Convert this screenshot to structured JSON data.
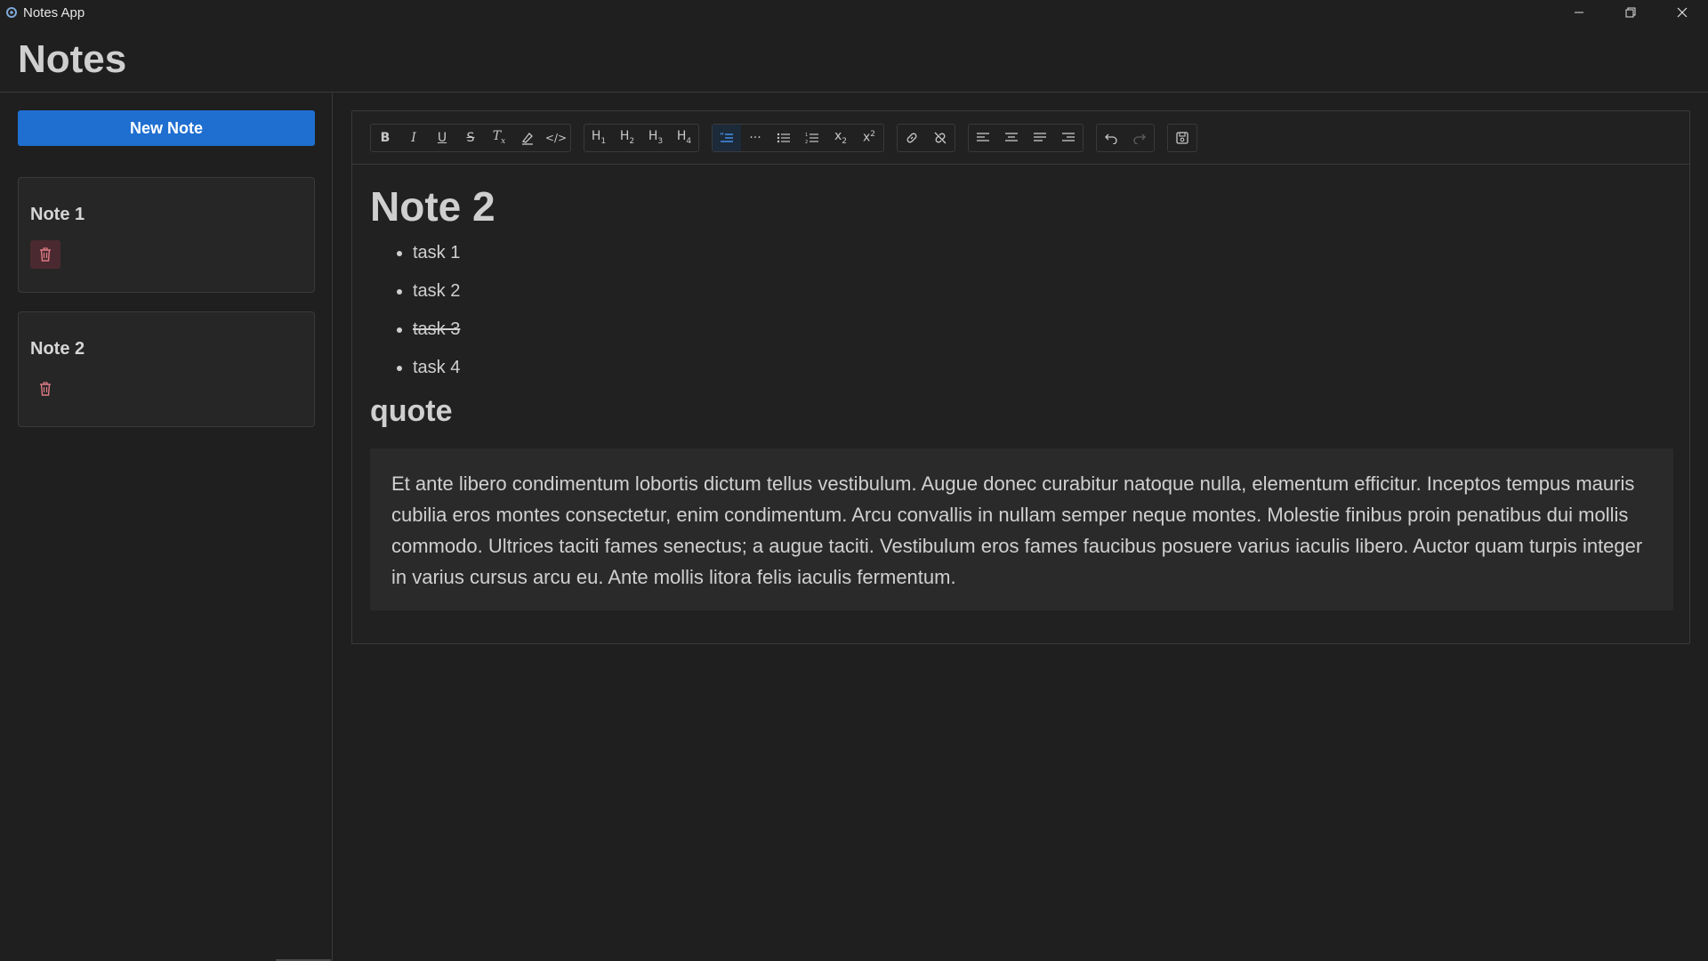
{
  "window": {
    "title": "Notes App",
    "controls": [
      "minimize",
      "maximize",
      "close"
    ]
  },
  "header": {
    "title": "Notes"
  },
  "sidebar": {
    "new_note_label": "New Note",
    "notes": [
      {
        "title": "Note 1"
      },
      {
        "title": "Note 2"
      }
    ]
  },
  "toolbar": {
    "groups": [
      [
        "bold",
        "italic",
        "underline",
        "strikethrough",
        "clear-format",
        "highlight",
        "code"
      ],
      [
        "heading-1",
        "heading-2",
        "heading-3",
        "heading-4"
      ],
      [
        "blockquote",
        "horizontal-rule",
        "bullet-list",
        "ordered-list",
        "subscript",
        "superscript"
      ],
      [
        "link",
        "unlink"
      ],
      [
        "align-left",
        "align-center",
        "align-justify",
        "align-right"
      ],
      [
        "undo",
        "redo"
      ],
      [
        "save"
      ]
    ],
    "active": [
      "blockquote"
    ],
    "disabled": [
      "redo"
    ]
  },
  "document": {
    "title": "Note 2",
    "tasks": [
      {
        "text": "task 1",
        "struck": false
      },
      {
        "text": "task 2",
        "struck": false
      },
      {
        "text": "task 3",
        "struck": true
      },
      {
        "text": "task 4",
        "struck": false
      }
    ],
    "subheading": "quote",
    "quote": "Et ante libero condimentum lobortis dictum tellus vestibulum. Augue donec curabitur natoque nulla, elementum efficitur. Inceptos tempus mauris cubilia eros montes consectetur, enim condimentum. Arcu convallis in nullam semper neque montes. Molestie finibus proin penatibus dui mollis commodo. Ultrices taciti fames senectus; a augue taciti. Vestibulum eros fames faucibus posuere varius iaculis libero. Auctor quam turpis integer in varius cursus arcu eu. Ante mollis litora felis iaculis fermentum."
  },
  "colors": {
    "background": "#1f1f1f",
    "accent": "#1f6fd1",
    "active_tool": "#4a9eff",
    "delete_active_bg": "#4a2a30",
    "delete_icon": "#e07b86"
  }
}
